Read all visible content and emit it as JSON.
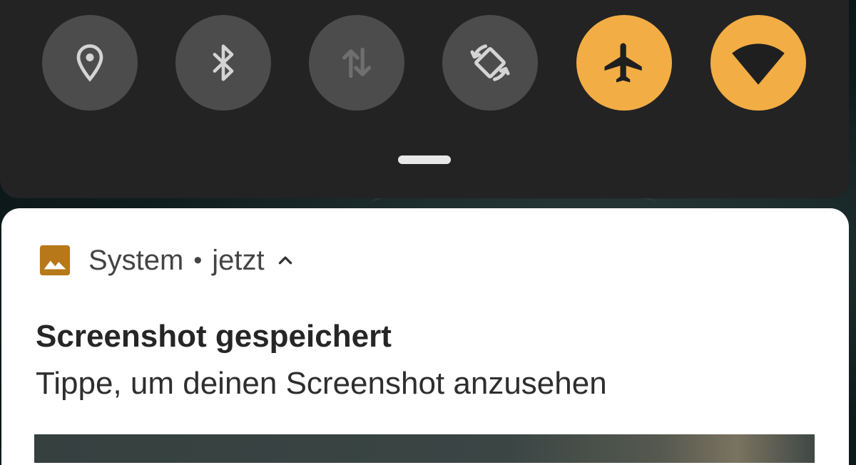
{
  "quick_settings": {
    "tiles": [
      {
        "name": "Location",
        "icon": "location-pin-icon",
        "active": false
      },
      {
        "name": "Bluetooth",
        "icon": "bluetooth-icon",
        "active": false
      },
      {
        "name": "Mobile data",
        "icon": "mobile-data-icon",
        "active": false
      },
      {
        "name": "Auto-rotate",
        "icon": "auto-rotate-icon",
        "active": false
      },
      {
        "name": "Airplane mode",
        "icon": "airplane-icon",
        "active": true
      },
      {
        "name": "Wi-Fi",
        "icon": "wifi-icon",
        "active": true
      }
    ],
    "colors": {
      "panel": "#232323",
      "tile_inactive": "#4c4c4c",
      "tile_active": "#f2ad45"
    }
  },
  "notification": {
    "app_icon": "image-icon",
    "app_name": "System",
    "separator": "•",
    "time": "jetzt",
    "expand_icon": "chevron-up-icon",
    "title": "Screenshot gespeichert",
    "text": "Tippe, um deinen Screenshot anzusehen",
    "accent": "#b7781a"
  }
}
